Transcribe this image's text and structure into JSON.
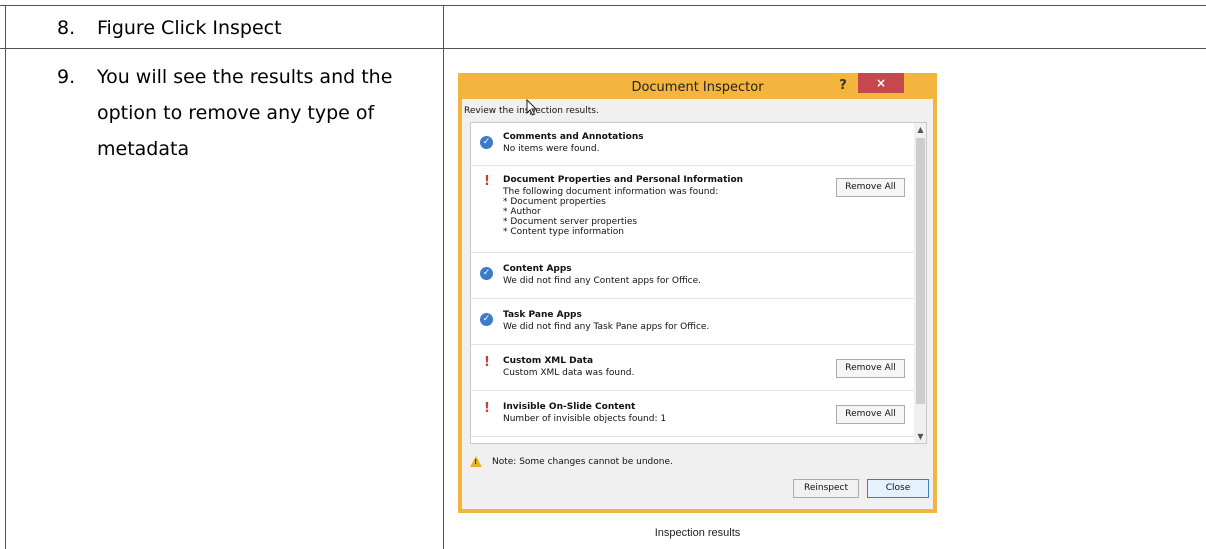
{
  "steps": [
    {
      "number": "8.",
      "text": "Figure Click Inspect"
    },
    {
      "number": "9.",
      "text": "You will see the results and the option to remove any type of metadata"
    }
  ],
  "dialog": {
    "title": "Document Inspector",
    "help_label": "?",
    "close_label": "×",
    "review_text": "Review the inspection results.",
    "items": [
      {
        "status": "ok",
        "title": "Comments and Annotations",
        "desc": "No items were found.",
        "remove_label": ""
      },
      {
        "status": "warning",
        "title": "Document Properties and Personal Information",
        "desc": "The following document information was found:\n* Document properties\n* Author\n* Document server properties\n* Content type information",
        "remove_label": "Remove All"
      },
      {
        "status": "ok",
        "title": "Content Apps",
        "desc": "We did not find any Content apps for Office.",
        "remove_label": ""
      },
      {
        "status": "ok",
        "title": "Task Pane Apps",
        "desc": "We did not find any Task Pane apps for Office.",
        "remove_label": ""
      },
      {
        "status": "warning",
        "title": "Custom XML Data",
        "desc": "Custom XML data was found.",
        "remove_label": "Remove All"
      },
      {
        "status": "warning",
        "title": "Invisible On-Slide Content",
        "desc": "Number of invisible objects found: 1",
        "remove_label": "Remove All"
      }
    ],
    "note": "Note: Some changes cannot be undone.",
    "reinspect_label": "Reinspect",
    "close_button_label": "Close"
  },
  "caption": "Inspection results",
  "colors": {
    "dialog_border": "#f3b53d",
    "close_red": "#c7474f",
    "ok_blue": "#3b7bc8",
    "warning_red": "#d23b2b"
  }
}
